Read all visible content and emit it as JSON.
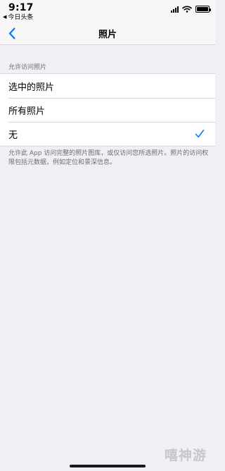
{
  "status_bar": {
    "time": "9:17",
    "back_app": "今日头条"
  },
  "nav": {
    "title": "照片"
  },
  "section": {
    "header": "允许访问照片",
    "options": [
      {
        "label": "选中的照片",
        "selected": false
      },
      {
        "label": "所有照片",
        "selected": false
      },
      {
        "label": "无",
        "selected": true
      }
    ],
    "footer": "允许此 App 访问完整的照片图库，或仅访问您所选照片。照片的访问权限包括元数据，例如定位和景深信息。"
  },
  "watermark": "嘻神游",
  "colors": {
    "accent": "#007aff",
    "background": "#efeff4",
    "secondary_text": "#6d6d72"
  }
}
